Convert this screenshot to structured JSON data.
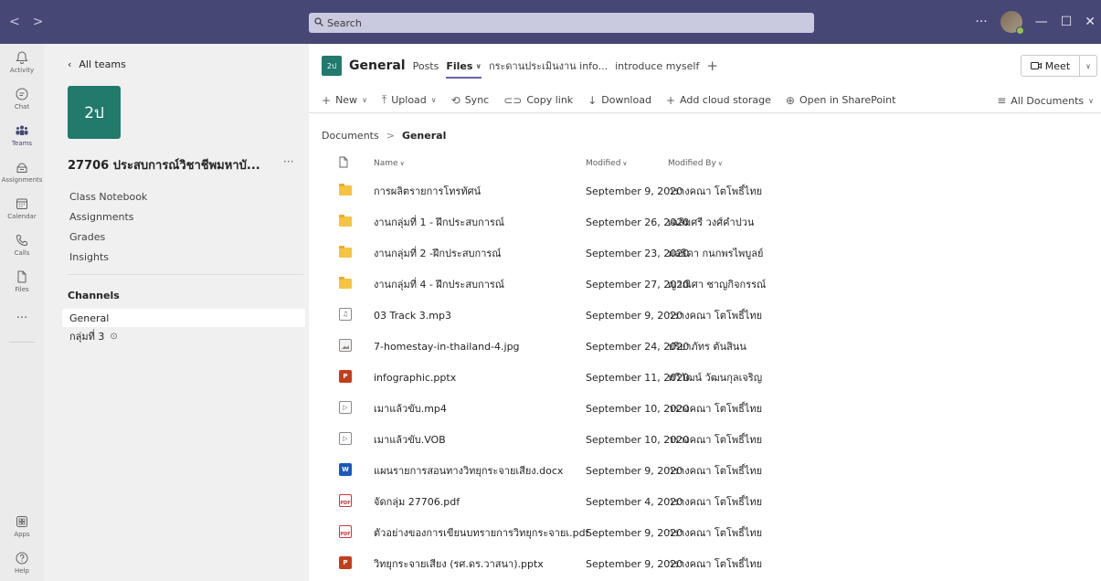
{
  "titlebar": {
    "back": "<",
    "forward": ">",
    "search_placeholder": "Search",
    "more": "···",
    "minimize": "—",
    "maximize": "☐",
    "close": "✕"
  },
  "rail": {
    "items": [
      {
        "label": "Activity",
        "icon": "bell-icon"
      },
      {
        "label": "Chat",
        "icon": "chat-icon"
      },
      {
        "label": "Teams",
        "icon": "teams-icon"
      },
      {
        "label": "Assignments",
        "icon": "assignments-icon"
      },
      {
        "label": "Calendar",
        "icon": "calendar-icon"
      },
      {
        "label": "Calls",
        "icon": "phone-icon"
      },
      {
        "label": "Files",
        "icon": "file-icon"
      }
    ],
    "more": "···",
    "apps_label": "Apps",
    "help_label": "Help"
  },
  "teampanel": {
    "all_teams": "All teams",
    "tile_text": "2ป",
    "team_name": "27706 ประสบการณ์วิชาชีพมหาบั...",
    "team_more": "···",
    "links": [
      "Class Notebook",
      "Assignments",
      "Grades",
      "Insights"
    ],
    "channels_header": "Channels",
    "channels": [
      {
        "name": "General",
        "active": true
      },
      {
        "name": "กลุ่มที่ 3",
        "active": false
      }
    ]
  },
  "channel": {
    "tile_text": "2ป",
    "title": "General",
    "tabs": [
      {
        "label": "Posts",
        "active": false
      },
      {
        "label": "Files",
        "active": true
      },
      {
        "label": "กระดานประเมินงาน info...",
        "active": false
      },
      {
        "label": "introduce myself",
        "active": false
      }
    ],
    "add_tab": "+",
    "meet_label": "Meet"
  },
  "commands": {
    "new": "New",
    "upload": "Upload",
    "sync": "Sync",
    "copy_link": "Copy link",
    "download": "Download",
    "add_cloud": "Add cloud storage",
    "open_sharepoint": "Open in SharePoint",
    "view": "All Documents"
  },
  "breadcrumb": {
    "root": "Documents",
    "sep": ">",
    "current": "General"
  },
  "table": {
    "headers": {
      "name": "Name",
      "modified": "Modified",
      "modified_by": "Modified By"
    },
    "rows": [
      {
        "type": "folder",
        "name": "การผลิตรายการโทรทัศน์",
        "modified": "September 9, 2020",
        "by": "วรางคณา โตโพธิ์ไทย"
      },
      {
        "type": "folder",
        "name": "งานกลุ่มที่ 1 - ฝึกประสบการณ์",
        "modified": "September 26, 2020",
        "by": "เฉลิมศรี วงศ์คำปวน"
      },
      {
        "type": "folder",
        "name": "งานกลุ่มที่ 2 -ฝึกประสบการณ์",
        "modified": "September 23, 2020",
        "by": "มลธิดา กนกพรไพบูลย์"
      },
      {
        "type": "folder",
        "name": "งานกลุ่มที่ 4 - ฝึกประสบการณ์",
        "modified": "September 27, 2020",
        "by": "ญาณิศา ชาญกิจกรรณ์"
      },
      {
        "type": "audio",
        "name": "03 Track 3.mp3",
        "modified": "September 9, 2020",
        "by": "วรางคณา โตโพธิ์ไทย"
      },
      {
        "type": "image",
        "name": "7-homestay-in-thailand-4.jpg",
        "modified": "September 24, 2020",
        "by": "ปริยาภัทร ตันสินน"
      },
      {
        "type": "ppt",
        "name": "infographic.pptx",
        "modified": "September 11, 2020",
        "by": "ทวีวัฒน์ วัฒนกุลเจริญ"
      },
      {
        "type": "video",
        "name": "เมาแล้วขับ.mp4",
        "modified": "September 10, 2020",
        "by": "วรางคณา โตโพธิ์ไทย"
      },
      {
        "type": "video",
        "name": "เมาแล้วขับ.VOB",
        "modified": "September 10, 2020",
        "by": "วรางคณา โตโพธิ์ไทย"
      },
      {
        "type": "word",
        "name": "แผนรายการสอนทางวิทยุกระจายเสียง.docx",
        "modified": "September 9, 2020",
        "by": "วรางคณา โตโพธิ์ไทย"
      },
      {
        "type": "pdf",
        "name": "จัดกลุ่ม 27706.pdf",
        "modified": "September 4, 2020",
        "by": "วรางคณา โตโพธิ์ไทย"
      },
      {
        "type": "pdf",
        "name": "ตัวอย่างของการเขียนบทรายการวิทยุกระจายเ.pdf",
        "modified": "September 9, 2020",
        "by": "วรางคณา โตโพธิ์ไทย"
      },
      {
        "type": "ppt",
        "name": "วิทยุกระจายเสียง (รศ.ดร.วาสนา).pptx",
        "modified": "September 9, 2020",
        "by": "วรางคณา โตโพธิ์ไทย"
      }
    ]
  },
  "colors": {
    "titlebar": "#464775",
    "accent": "#6264a7",
    "team_tile": "#217a6c",
    "folder": "#f6c342"
  }
}
